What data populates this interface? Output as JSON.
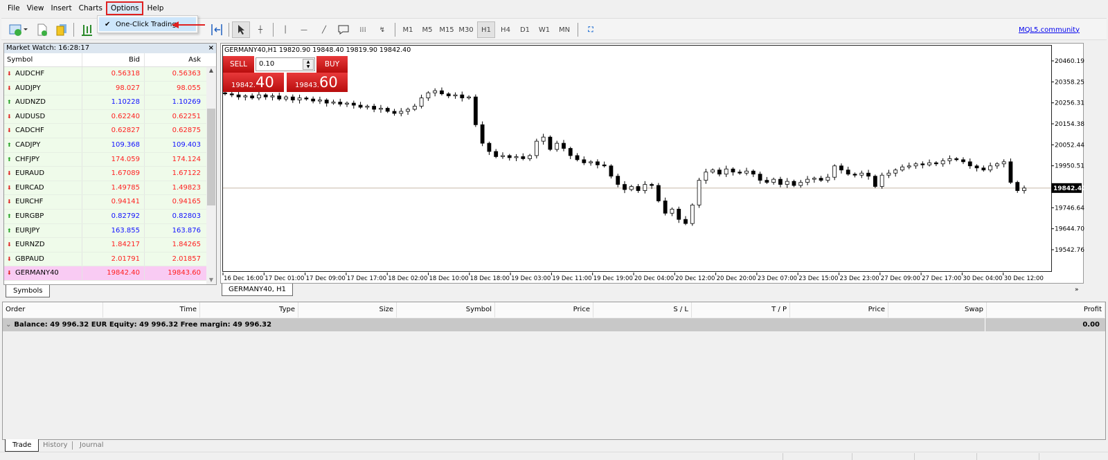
{
  "menu": [
    "File",
    "View",
    "Insert",
    "Charts",
    "Options",
    "Help"
  ],
  "options_menu": {
    "item": "One-Click Trading",
    "checked": true
  },
  "toolbar": {
    "timeframes": [
      "M1",
      "M5",
      "M15",
      "M30",
      "H1",
      "H4",
      "D1",
      "W1",
      "MN"
    ],
    "selected_timeframe": "H1",
    "community_link": "MQL5.community"
  },
  "market_watch": {
    "title": "Market Watch: 16:28:17",
    "columns": [
      "Symbol",
      "Bid",
      "Ask"
    ],
    "rows": [
      {
        "symbol": "AUDCHF",
        "bid": "0.56318",
        "ask": "0.56363",
        "arrow": "down",
        "color": "#ff2020"
      },
      {
        "symbol": "AUDJPY",
        "bid": "98.027",
        "ask": "98.055",
        "arrow": "down",
        "color": "#ff2020"
      },
      {
        "symbol": "AUDNZD",
        "bid": "1.10228",
        "ask": "1.10269",
        "arrow": "up",
        "color": "#1010ff"
      },
      {
        "symbol": "AUDUSD",
        "bid": "0.62240",
        "ask": "0.62251",
        "arrow": "down",
        "color": "#ff2020"
      },
      {
        "symbol": "CADCHF",
        "bid": "0.62827",
        "ask": "0.62875",
        "arrow": "down",
        "color": "#ff2020"
      },
      {
        "symbol": "CADJPY",
        "bid": "109.368",
        "ask": "109.403",
        "arrow": "up",
        "color": "#1010ff"
      },
      {
        "symbol": "CHFJPY",
        "bid": "174.059",
        "ask": "174.124",
        "arrow": "up",
        "color": "#ff2020"
      },
      {
        "symbol": "EURAUD",
        "bid": "1.67089",
        "ask": "1.67122",
        "arrow": "down",
        "color": "#ff2020"
      },
      {
        "symbol": "EURCAD",
        "bid": "1.49785",
        "ask": "1.49823",
        "arrow": "down",
        "color": "#ff2020"
      },
      {
        "symbol": "EURCHF",
        "bid": "0.94141",
        "ask": "0.94165",
        "arrow": "down",
        "color": "#ff2020"
      },
      {
        "symbol": "EURGBP",
        "bid": "0.82792",
        "ask": "0.82803",
        "arrow": "up",
        "color": "#1010ff"
      },
      {
        "symbol": "EURJPY",
        "bid": "163.855",
        "ask": "163.876",
        "arrow": "up",
        "color": "#1010ff"
      },
      {
        "symbol": "EURNZD",
        "bid": "1.84217",
        "ask": "1.84265",
        "arrow": "down",
        "color": "#ff2020"
      },
      {
        "symbol": "GBPAUD",
        "bid": "2.01791",
        "ask": "2.01857",
        "arrow": "down",
        "color": "#ff2020"
      },
      {
        "symbol": "GERMANY40",
        "bid": "19842.40",
        "ask": "19843.60",
        "arrow": "down",
        "color": "#ff2020",
        "highlight": true
      }
    ],
    "tab": "Symbols"
  },
  "chart": {
    "header": "GERMANY40,H1  19820.90 19848.40 19819.90 19842.40",
    "tab": "GERMANY40, H1",
    "one_click": {
      "sell": "SELL",
      "buy": "BUY",
      "volume": "0.10",
      "sell_price_small": "19842.",
      "sell_price_big": "40",
      "buy_price_small": "19843.",
      "buy_price_big": "60"
    },
    "price_ticks": [
      "20460.19",
      "20358.25",
      "20256.31",
      "20154.38",
      "20052.44",
      "19950.51",
      "19746.64",
      "19644.70",
      "19542.76"
    ],
    "current_price": "19842.40",
    "time_ticks": [
      "16 Dec 16:00",
      "17 Dec 01:00",
      "17 Dec 09:00",
      "17 Dec 17:00",
      "18 Dec 02:00",
      "18 Dec 10:00",
      "18 Dec 18:00",
      "19 Dec 03:00",
      "19 Dec 11:00",
      "19 Dec 19:00",
      "20 Dec 04:00",
      "20 Dec 12:00",
      "20 Dec 20:00",
      "23 Dec 07:00",
      "23 Dec 15:00",
      "23 Dec 23:00",
      "27 Dec 09:00",
      "27 Dec 17:00",
      "30 Dec 04:00",
      "30 Dec 12:00"
    ],
    "closes": [
      20300,
      20295,
      20285,
      20290,
      20280,
      20295,
      20285,
      20290,
      20275,
      20285,
      20270,
      20280,
      20275,
      20265,
      20270,
      20255,
      20260,
      20250,
      20255,
      20245,
      20235,
      20240,
      20225,
      20230,
      20215,
      20205,
      20215,
      20225,
      20240,
      20280,
      20305,
      20315,
      20300,
      20290,
      20295,
      20280,
      20285,
      20150,
      20060,
      20020,
      19995,
      20000,
      19990,
      19995,
      19985,
      20000,
      20070,
      20090,
      20030,
      20060,
      20035,
      20000,
      19980,
      19965,
      19970,
      19955,
      19950,
      19900,
      19860,
      19835,
      19850,
      19830,
      19860,
      19855,
      19780,
      19720,
      19740,
      19690,
      19670,
      19760,
      19880,
      19920,
      19930,
      19910,
      19935,
      19920,
      19915,
      19925,
      19910,
      19880,
      19870,
      19885,
      19860,
      19875,
      19855,
      19870,
      19885,
      19890,
      19880,
      19895,
      19950,
      19930,
      19910,
      19905,
      19915,
      19900,
      19850,
      19905,
      19915,
      19930,
      19945,
      19950,
      19960,
      19955,
      19965,
      19960,
      19975,
      19985,
      19980,
      19970,
      19950,
      19940,
      19930,
      19950,
      19960,
      19970,
      19870,
      19830,
      19842.4
    ]
  },
  "terminal": {
    "columns": [
      "Order",
      "Time",
      "Type",
      "Size",
      "Symbol",
      "Price",
      "S / L",
      "T / P",
      "Price",
      "Swap",
      "Profit"
    ],
    "balance_line": "Balance: 49 996.32 EUR  Equity: 49 996.32  Free margin: 49 996.32",
    "profit_total": "0.00",
    "tabs": [
      "Trade",
      "History",
      "Journal"
    ],
    "active_tab": "Trade"
  }
}
